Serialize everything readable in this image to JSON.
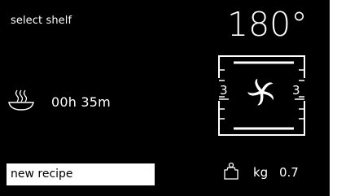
{
  "header": {
    "hint": "select shelf",
    "temperature": "180°"
  },
  "timer": {
    "icon": "cooking-pot-steam-icon",
    "value": "00h 35m"
  },
  "oven": {
    "fan_icon": "fan-icon",
    "shelf_left": "3",
    "shelf_right": "3"
  },
  "recipe": {
    "button_label": "new recipe"
  },
  "weight": {
    "icon": "weight-icon",
    "unit": "kg",
    "value": "0.7"
  }
}
